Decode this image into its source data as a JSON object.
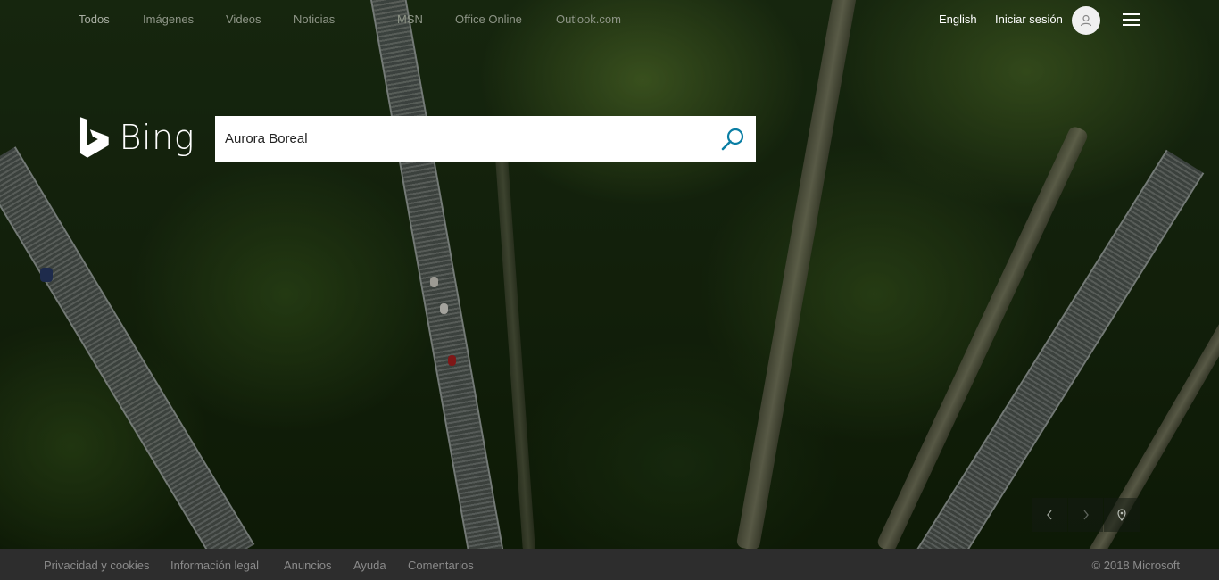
{
  "nav": {
    "items": [
      {
        "label": "Todos",
        "active": true
      },
      {
        "label": "Imágenes",
        "active": false
      },
      {
        "label": "Videos",
        "active": false
      },
      {
        "label": "Noticias",
        "active": false
      },
      {
        "label": "MSN",
        "active": false
      },
      {
        "label": "Office Online",
        "active": false
      },
      {
        "label": "Outlook.com",
        "active": false
      }
    ],
    "language": "English",
    "signin": "Iniciar sesión"
  },
  "logo": {
    "text": "Bing"
  },
  "search": {
    "value": "Aurora Boreal",
    "placeholder": ""
  },
  "image_controls": {
    "icons": [
      "chevron-left-icon",
      "chevron-right-icon",
      "location-pin-icon"
    ]
  },
  "footer": {
    "links": [
      "Privacidad y cookies",
      "Información legal",
      "Anuncios",
      "Ayuda",
      "Comentarios"
    ],
    "copyright": "© 2018 Microsoft"
  },
  "colors": {
    "accent": "#0a7ea4",
    "footer_bg": "#2d2d2d"
  }
}
